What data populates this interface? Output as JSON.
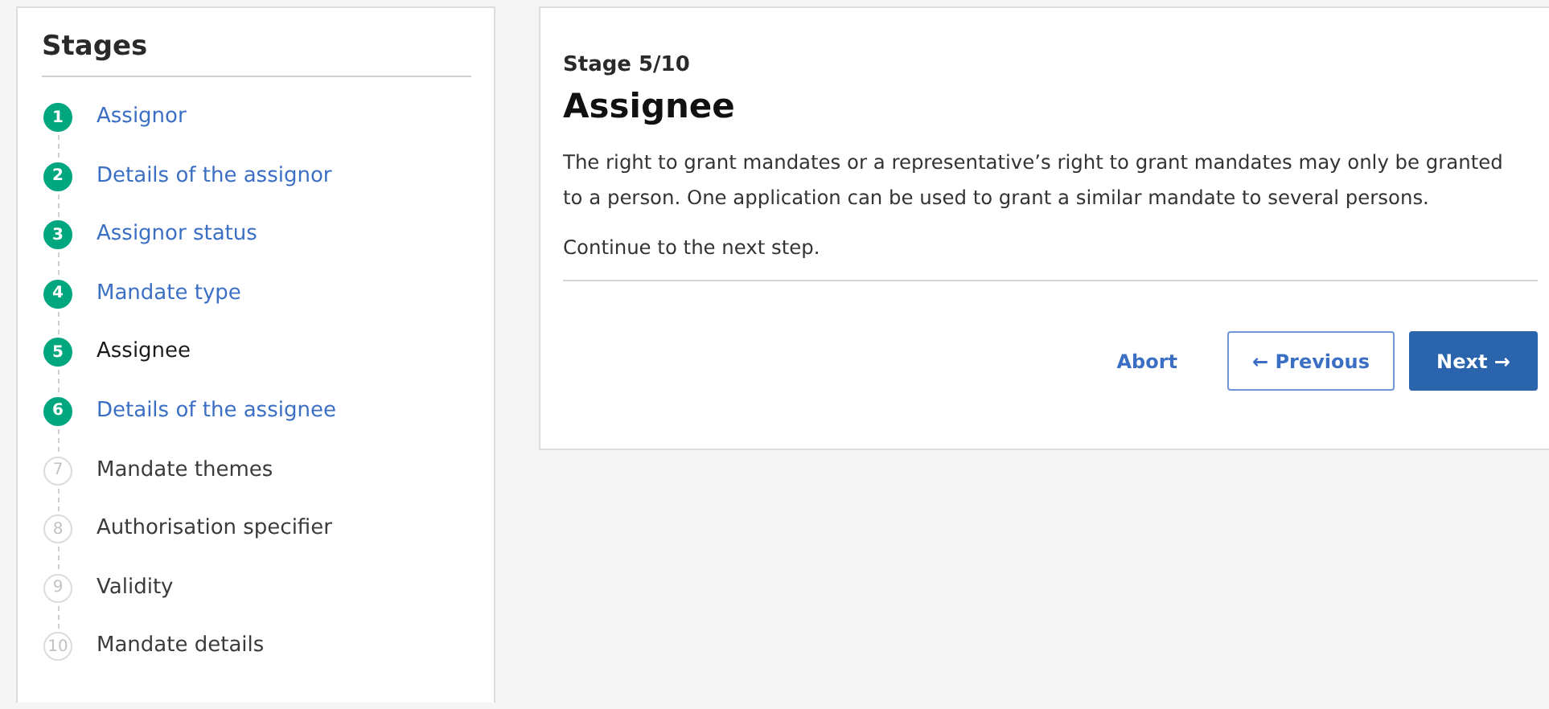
{
  "sidebar": {
    "title": "Stages",
    "stages": [
      {
        "number": "1",
        "label": "Assignor",
        "reached": true,
        "selected": false
      },
      {
        "number": "2",
        "label": "Details of the assignor",
        "reached": true,
        "selected": false
      },
      {
        "number": "3",
        "label": "Assignor status",
        "reached": true,
        "selected": false
      },
      {
        "number": "4",
        "label": "Mandate type",
        "reached": true,
        "selected": false
      },
      {
        "number": "5",
        "label": "Assignee",
        "reached": true,
        "selected": true
      },
      {
        "number": "6",
        "label": "Details of the assignee",
        "reached": true,
        "selected": false
      },
      {
        "number": "7",
        "label": "Mandate themes",
        "reached": false,
        "selected": false
      },
      {
        "number": "8",
        "label": "Authorisation specifier",
        "reached": false,
        "selected": false
      },
      {
        "number": "9",
        "label": "Validity",
        "reached": false,
        "selected": false
      },
      {
        "number": "10",
        "label": "Mandate details",
        "reached": false,
        "selected": false
      }
    ]
  },
  "main": {
    "stage": "Stage 5/10",
    "title": "Assignee",
    "paragraphs": [
      "The right to grant mandates or a representative’s right to grant mandates may only be granted to a person. One application can be used to grant a similar mandate to several persons.",
      "Continue to the next step."
    ],
    "buttons": [
      {
        "label": "Abort",
        "kind": "link"
      },
      {
        "label": "← Previous",
        "kind": "secondary"
      },
      {
        "label": "Next →",
        "kind": "primary"
      }
    ]
  }
}
